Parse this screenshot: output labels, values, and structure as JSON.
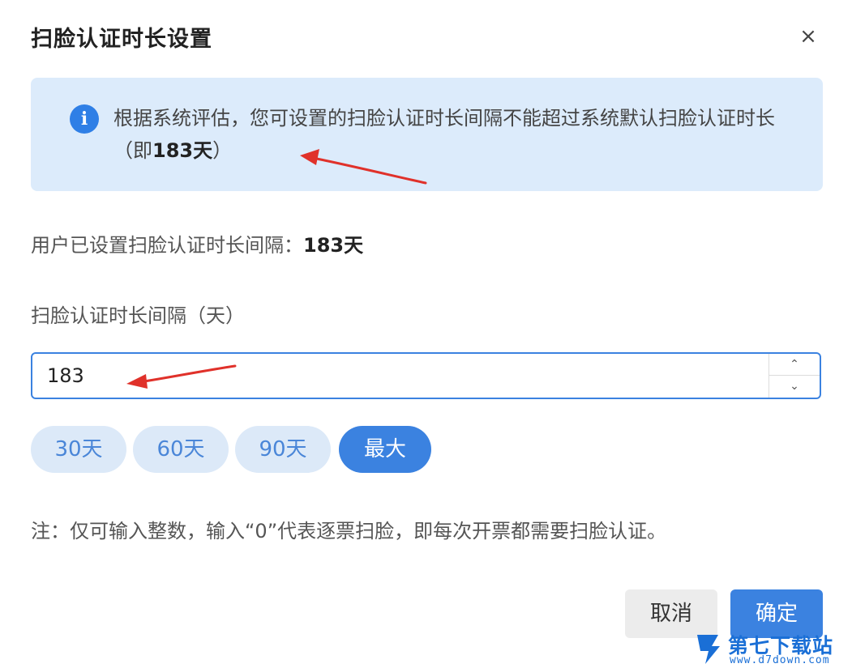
{
  "dialog": {
    "title": "扫脸认证时长设置",
    "close_symbol": "×"
  },
  "notice": {
    "icon": "info-icon",
    "icon_glyph": "i",
    "text_before": "根据系统评估，您可设置的扫脸认证时长间隔不能超过系统默认扫脸认证时长（即",
    "highlight": "183天",
    "text_after": "）"
  },
  "current": {
    "label": "用户已设置扫脸认证时长间隔：",
    "value": "183天"
  },
  "field": {
    "label": "扫脸认证时长间隔（天）",
    "value": "183",
    "up_symbol": "⌃",
    "down_symbol": "⌄"
  },
  "presets": [
    {
      "label": "30天",
      "active": false
    },
    {
      "label": "60天",
      "active": false
    },
    {
      "label": "90天",
      "active": false
    },
    {
      "label": "最大",
      "active": true
    }
  ],
  "note": "注：仅可输入整数，输入“0”代表逐票扫脸，即每次开票都需要扫脸认证。",
  "buttons": {
    "cancel": "取消",
    "confirm": "确定"
  },
  "watermark": {
    "title": "第七下载站",
    "url": "www.d7down.com"
  },
  "colors": {
    "primary": "#3b82e0",
    "notice_bg": "#dcebfb",
    "chip_bg": "#dce9f8",
    "arrow": "#e0312a"
  }
}
